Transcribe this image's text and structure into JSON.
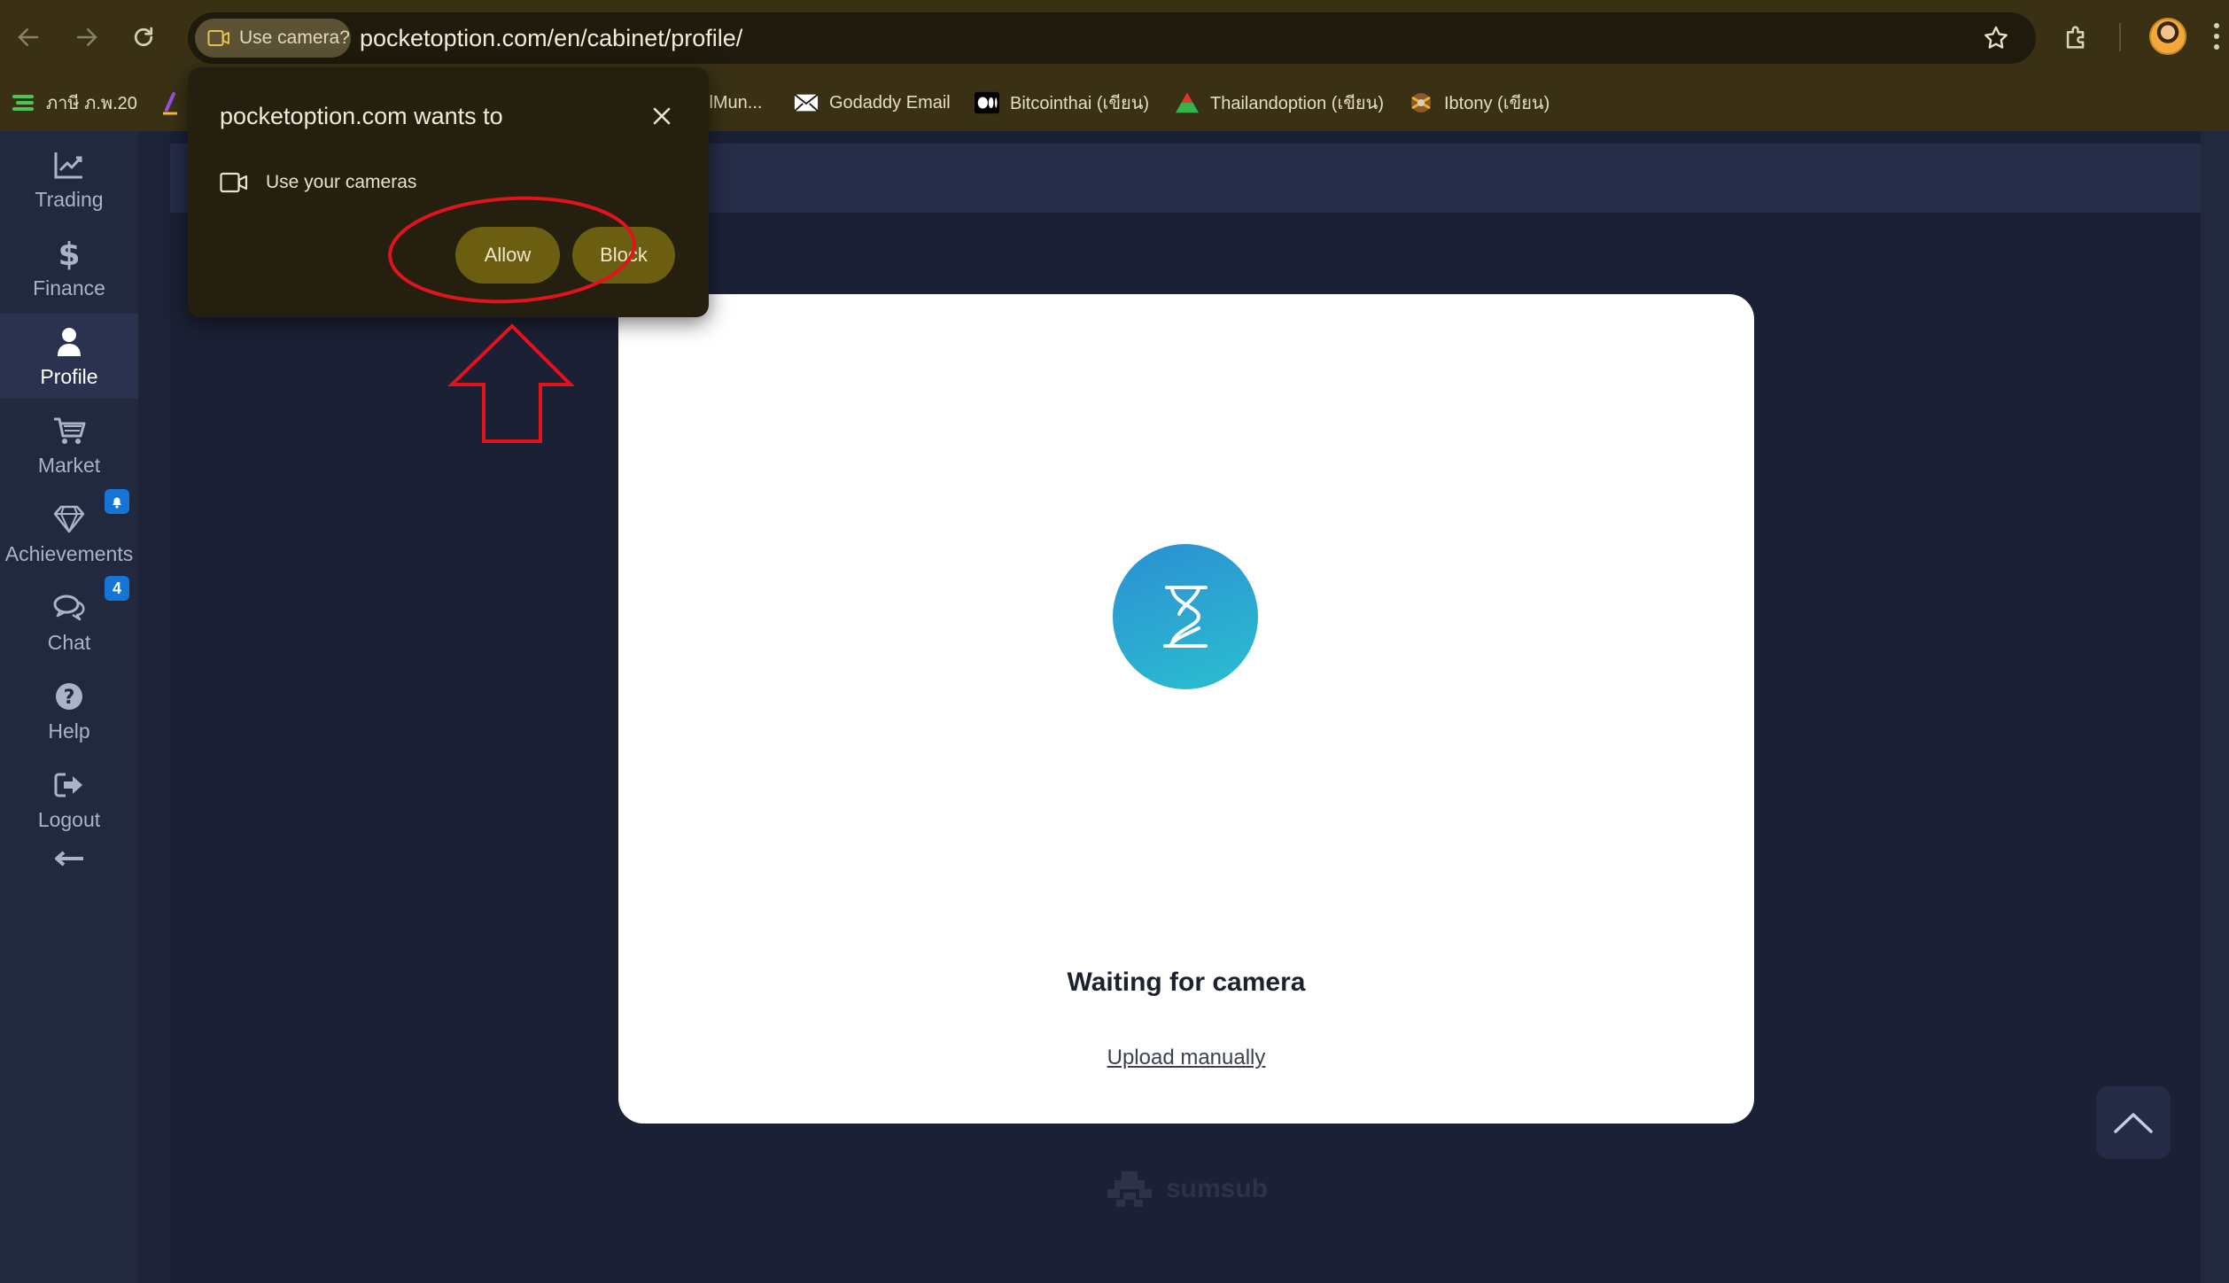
{
  "browser": {
    "camera_chip_label": "Use camera?",
    "url": "pocketoption.com/en/cabinet/profile/",
    "bookmarks": [
      {
        "label": "ภาษี ภ.พ.20",
        "icon": "green-lines-icon"
      },
      {
        "label": "ilMun...",
        "icon": "purple-icon"
      },
      {
        "label": "Godaddy Email",
        "icon": "email-icon"
      },
      {
        "label": "Bitcointhai (เขียน)",
        "icon": "medium-icon"
      },
      {
        "label": "Thailandoption (เขียน)",
        "icon": "triangle-icon"
      },
      {
        "label": "Ibtony (เขียน)",
        "icon": "ibtony-icon"
      }
    ]
  },
  "popup": {
    "title": "pocketoption.com wants to",
    "permission": "Use your cameras",
    "allow_label": "Allow",
    "block_label": "Block"
  },
  "sidebar": {
    "items": [
      {
        "label": "Trading",
        "icon": "chart-icon"
      },
      {
        "label": "Finance",
        "icon": "dollar-icon"
      },
      {
        "label": "Profile",
        "icon": "user-icon",
        "active": true
      },
      {
        "label": "Market",
        "icon": "cart-icon"
      },
      {
        "label": "Achievements",
        "icon": "diamond-icon"
      },
      {
        "label": "Chat",
        "icon": "chat-icon",
        "badge": "4"
      },
      {
        "label": "Help",
        "icon": "help-icon"
      },
      {
        "label": "Logout",
        "icon": "logout-icon"
      }
    ]
  },
  "card": {
    "status": "Waiting for camera",
    "upload_link": "Upload manually"
  },
  "footer": {
    "brand": "sumsub"
  },
  "colors": {
    "browser_chrome": "#3a3115",
    "popup_bg": "#241f0e",
    "popup_button": "#6b5e10",
    "sidebar_bg": "#22283d",
    "page_bg": "#1b2035",
    "accent_blue": "#1575d6",
    "annotation_red": "#e0141b"
  }
}
